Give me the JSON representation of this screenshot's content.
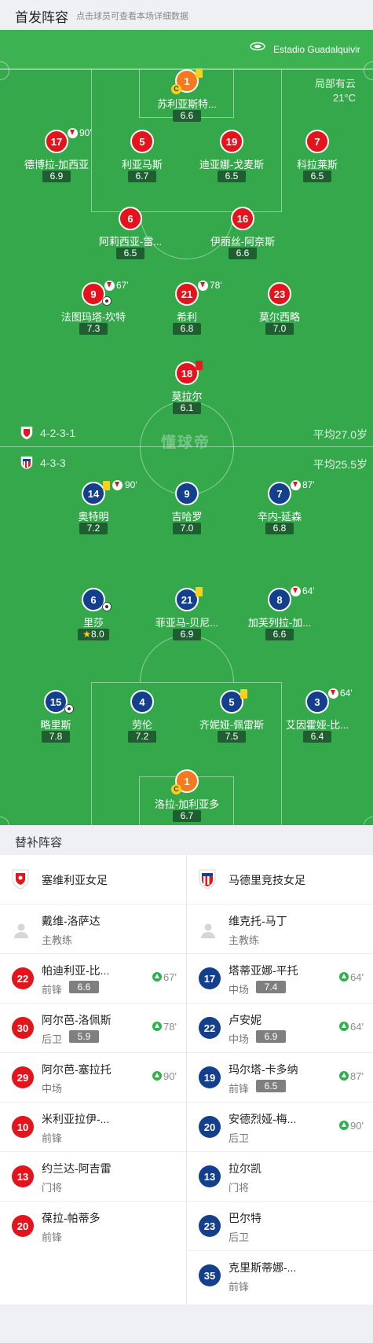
{
  "header": {
    "title": "首发阵容",
    "subtitle": "点击球员可查看本场详细数据"
  },
  "stadium": {
    "name": "Estadio Guadalquivir"
  },
  "weather": {
    "condition": "局部有云",
    "temp": "21°C"
  },
  "watermark": "懂球帝",
  "home": {
    "formation": "4-2-3-1",
    "avg_age": "平均27.0岁",
    "color": "#e3141b"
  },
  "away": {
    "formation": "4-3-3",
    "avg_age": "平均25.5岁",
    "color": "#133f8c"
  },
  "players": [
    {
      "num": "1",
      "name": "苏利亚斯特...",
      "rating": "6.6"
    },
    {
      "num": "17",
      "name": "德博拉-加西亚",
      "rating": "6.9",
      "sub_min": "90'"
    },
    {
      "num": "5",
      "name": "利亚马斯",
      "rating": "6.7"
    },
    {
      "num": "19",
      "name": "迪亚娜-戈麦斯",
      "rating": "6.5"
    },
    {
      "num": "7",
      "name": "科拉莱斯",
      "rating": "6.5"
    },
    {
      "num": "6",
      "name": "阿莉西亚-雷...",
      "rating": "6.5"
    },
    {
      "num": "16",
      "name": "伊丽丝-阿奈斯",
      "rating": "6.6"
    },
    {
      "num": "9",
      "name": "法图玛塔-坎特",
      "rating": "7.3",
      "sub_min": "67'"
    },
    {
      "num": "21",
      "name": "希利",
      "rating": "6.8",
      "sub_min": "78'"
    },
    {
      "num": "23",
      "name": "莫尔西略",
      "rating": "7.0"
    },
    {
      "num": "18",
      "name": "莫拉尔",
      "rating": "6.1"
    },
    {
      "num": "14",
      "name": "奥特明",
      "rating": "7.2",
      "sub_min": "90'"
    },
    {
      "num": "9",
      "name": "吉哈罗",
      "rating": "7.0"
    },
    {
      "num": "7",
      "name": "辛内-延森",
      "rating": "6.8",
      "sub_min": "87'"
    },
    {
      "num": "6",
      "name": "里莎",
      "rating": "8.0"
    },
    {
      "num": "21",
      "name": "菲亚马-贝尼...",
      "rating": "6.9"
    },
    {
      "num": "8",
      "name": "加芙列拉-加...",
      "rating": "6.6",
      "sub_min": "64'"
    },
    {
      "num": "15",
      "name": "略里斯",
      "rating": "7.8"
    },
    {
      "num": "4",
      "name": "劳伦",
      "rating": "7.2"
    },
    {
      "num": "5",
      "name": "齐妮娅-佩雷斯",
      "rating": "7.5"
    },
    {
      "num": "3",
      "name": "艾因霍娅-比...",
      "rating": "6.4",
      "sub_min": "64'"
    },
    {
      "num": "1",
      "name": "洛拉-加利亚多",
      "rating": "6.7"
    }
  ],
  "bench": {
    "title": "替补阵容",
    "home": {
      "team": "塞维利亚女足",
      "coach": {
        "name": "戴维-洛萨达",
        "role": "主教练"
      },
      "subs": [
        {
          "num": "22",
          "name": "帕迪利亚-比...",
          "pos": "前锋",
          "rating": "6.6",
          "minute": "67'"
        },
        {
          "num": "30",
          "name": "阿尔芭-洛佩斯",
          "pos": "后卫",
          "rating": "5.9",
          "minute": "78'"
        },
        {
          "num": "29",
          "name": "阿尔芭-塞拉托",
          "pos": "中场",
          "minute": "90'"
        },
        {
          "num": "10",
          "name": "米利亚拉伊-...",
          "pos": "前锋"
        },
        {
          "num": "13",
          "name": "约兰达-阿吉雷",
          "pos": "门将"
        },
        {
          "num": "20",
          "name": "葆拉-帕蒂多",
          "pos": "前锋"
        }
      ]
    },
    "away": {
      "team": "马德里竞技女足",
      "coach": {
        "name": "维克托-马丁",
        "role": "主教练"
      },
      "subs": [
        {
          "num": "17",
          "name": "塔蒂亚娜-平托",
          "pos": "中场",
          "rating": "7.4",
          "minute": "64'"
        },
        {
          "num": "22",
          "name": "卢安妮",
          "pos": "中场",
          "rating": "6.9",
          "minute": "64'"
        },
        {
          "num": "19",
          "name": "玛尔塔-卡多纳",
          "pos": "前锋",
          "rating": "6.5",
          "minute": "87'"
        },
        {
          "num": "20",
          "name": "安德烈娅-梅...",
          "pos": "后卫",
          "minute": "90'"
        },
        {
          "num": "13",
          "name": "拉尔凯",
          "pos": "门将"
        },
        {
          "num": "23",
          "name": "巴尔特",
          "pos": "后卫"
        },
        {
          "num": "35",
          "name": "克里斯蒂娜-...",
          "pos": "前锋"
        }
      ]
    }
  }
}
